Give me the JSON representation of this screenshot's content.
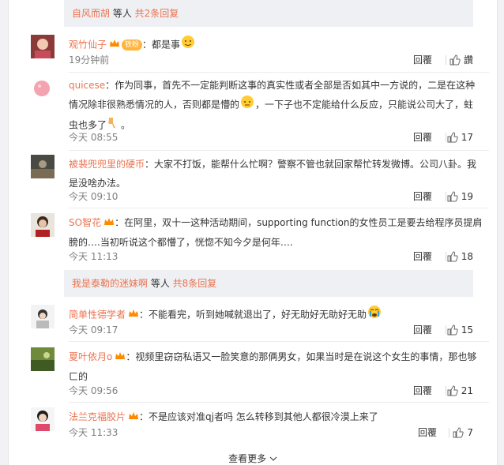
{
  "thread_top": {
    "user": "自风而胡",
    "middle": " 等人 ",
    "count": "共2条回复"
  },
  "thread_mid": {
    "user": "我是泰勒的迷妹啊",
    "middle": " 等人 ",
    "count": "共8条回复"
  },
  "comments": [
    {
      "user": "观竹仙子",
      "badge": "铁粉",
      "text": "：都是事",
      "time": "19分钟前",
      "reply": "回覆",
      "like": "讚"
    },
    {
      "user": "quicese",
      "text": "：作为同事，首先不一定能判断这事的真实性或者全部是否如其中一方说的，二是在这种情况除非很熟悉情况的人，否则都是懵的",
      "text2": "，一下子也不定能给什么反应，只能说公司大了，蛀虫也多了",
      "text3": "。",
      "time": "今天 08:55",
      "reply": "回覆",
      "like": "17"
    },
    {
      "user": "被裴兜兜里的硬币",
      "text": "：大家不打饭，能帮什么忙啊？警察不管也就回家帮忙转发微博。公司八卦。我是没啥办法。",
      "time": "今天 09:10",
      "reply": "回覆",
      "like": "19"
    },
    {
      "user": "SO智花",
      "text": "：在阿里，双十一这种活动期间，supporting function的女性员工是要去给程序员提肩膀的….当初听说这个都懵了，恍惚不知今夕是何年….",
      "time": "今天 11:13",
      "reply": "回覆",
      "like": "18"
    },
    {
      "user": "简单性德学者",
      "text": "：不能看完，听到她喊就退出了，好无助好无助好无助",
      "time": "今天 09:17",
      "reply": "回覆",
      "like": "15"
    },
    {
      "user": "夏叶依月o",
      "text": "：视频里窃窃私语又一脸笑意的那俩男女，如果当时是在说这个女生的事情，那也够ㄈ的",
      "time": "今天 09:56",
      "reply": "回覆",
      "like": "21"
    },
    {
      "user": "法兰克福胶片",
      "text": "：不是应该对准qj者吗 怎么转移到其他人都很冷漠上来了",
      "time": "今天 11:33",
      "reply": "回覆",
      "like": "7"
    }
  ],
  "see_more": "查看更多"
}
